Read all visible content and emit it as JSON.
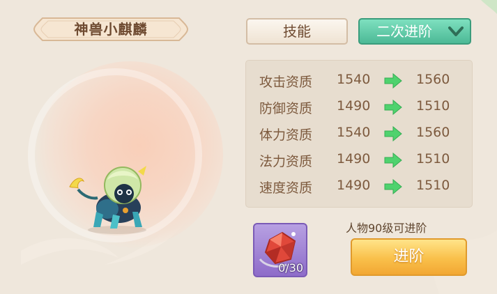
{
  "pet": {
    "name": "神兽小麒麟"
  },
  "tabs": {
    "skills_label": "技能",
    "advance_dropdown_label": "二次进阶"
  },
  "stats": [
    {
      "label": "攻击资质",
      "before": "1540",
      "after": "1560"
    },
    {
      "label": "防御资质",
      "before": "1490",
      "after": "1510"
    },
    {
      "label": "体力资质",
      "before": "1540",
      "after": "1560"
    },
    {
      "label": "法力资质",
      "before": "1490",
      "after": "1510"
    },
    {
      "label": "速度资质",
      "before": "1490",
      "after": "1510"
    }
  ],
  "material": {
    "count": "0/30",
    "icon": "red-crystal-icon"
  },
  "requirement": "人物90级可进阶",
  "advance_button_label": "进阶",
  "colors": {
    "panel_bg": "#efe7dc",
    "text_brown": "#7d5a3e",
    "arrow_green": "#4fd26e",
    "dropdown_green": "#4cb996",
    "advance_orange": "#f9c04a",
    "material_purple": "#8e6cc9"
  }
}
